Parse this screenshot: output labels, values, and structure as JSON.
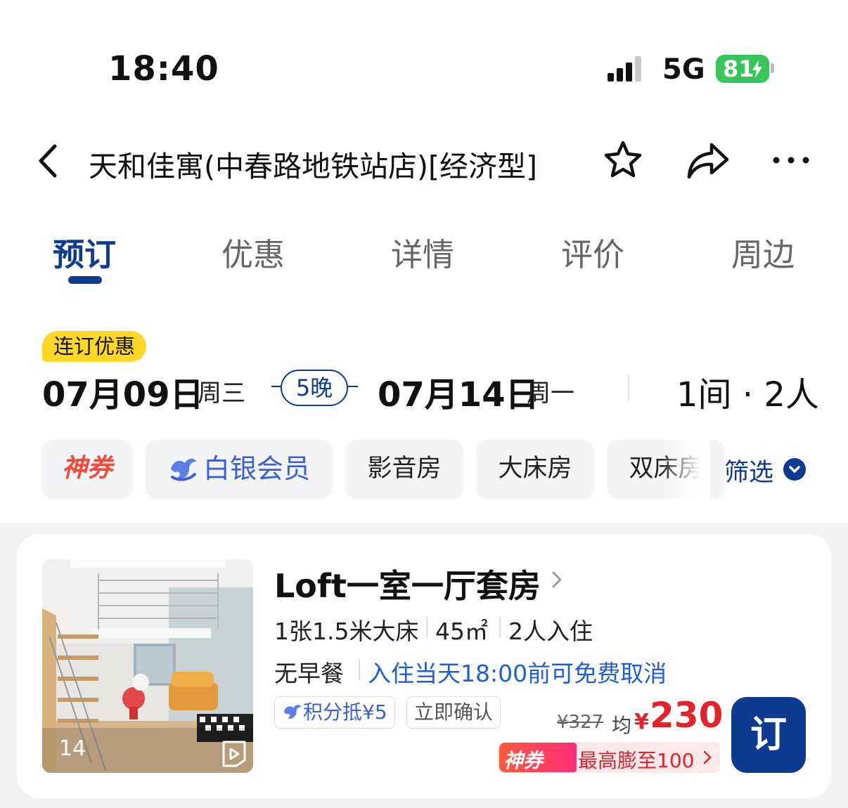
{
  "status_bar": {
    "time": "18:40",
    "network": "5G",
    "battery": "81",
    "icons": [
      "signal-icon",
      "battery-icon",
      "charging-bolt-icon"
    ]
  },
  "nav": {
    "title": "天和佳寓(中春路地铁站店)[经济型]",
    "icons": [
      "back-arrow-icon",
      "star-icon",
      "share-icon",
      "more-icon"
    ]
  },
  "tabs": [
    {
      "label": "预订",
      "active": true
    },
    {
      "label": "优惠",
      "active": false
    },
    {
      "label": "详情",
      "active": false
    },
    {
      "label": "评价",
      "active": false
    },
    {
      "label": "周边",
      "active": false
    }
  ],
  "stay": {
    "promo_badge": "连订优惠",
    "checkin_date": "07月09日",
    "checkin_weekday": "周三",
    "nights": "5晚",
    "checkout_date": "07月14日",
    "checkout_weekday": "周一",
    "rooms_guests": "1间 · 2人"
  },
  "filters": {
    "chips": [
      "神券",
      "白银会员",
      "影音房",
      "大床房",
      "双床房"
    ],
    "filter_label": "筛选"
  },
  "room": {
    "name": "Loft一室一厅套房",
    "bed": "1张1.5米大床",
    "area": "45㎡",
    "occupancy": "2人入住",
    "breakfast": "无早餐",
    "cancel_policy": "入住当天18:00前可免费取消",
    "tags": [
      "积分抵¥5",
      "立即确认"
    ],
    "photo_count": "14",
    "original_price": "¥327",
    "avg_label": "均",
    "currency": "¥",
    "price": "230",
    "book_label": "订",
    "promo_badge": "神券",
    "promo_text": "最高膨至100"
  },
  "colors": {
    "brand_blue": "#0c3b8f",
    "price_red": "#e3232c",
    "link_blue": "#1f5fd6",
    "promo_yellow": "#ffd827",
    "battery_green": "#35c759"
  }
}
